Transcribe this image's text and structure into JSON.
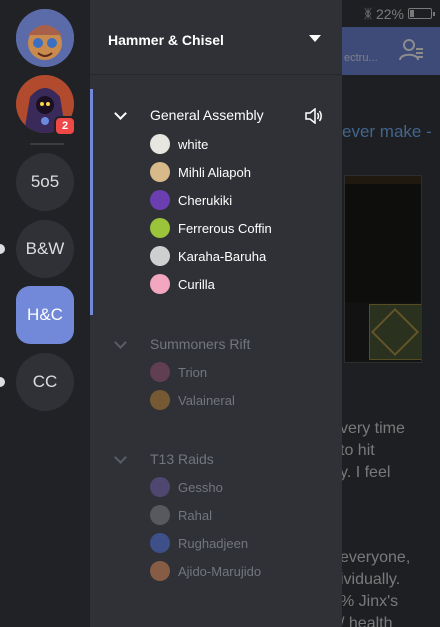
{
  "status_bar": {
    "battery_text": "22%",
    "battery_level": 0.22
  },
  "chat_header": {
    "topic_fragment": "ectru..."
  },
  "chat_background": {
    "link_text": "ever make -",
    "lines_block_1": [
      "very time",
      "to hit",
      "y. I feel"
    ],
    "lines_block_2": [
      "everyone,",
      "ividually.",
      "% Jinx's",
      "/ health"
    ]
  },
  "guilds": [
    {
      "label": "",
      "icon": "avatar-teemo",
      "active": false
    },
    {
      "label": "",
      "icon": "avatar-dark-mage",
      "active": false,
      "mention_count": "2"
    },
    {
      "label": "5o5",
      "active": false
    },
    {
      "label": "B&W",
      "active": false,
      "unread": true
    },
    {
      "label": "H&C",
      "active": true
    },
    {
      "label": "CC",
      "active": false,
      "unread": true
    }
  ],
  "server": {
    "name": "Hammer & Chisel"
  },
  "voice_categories": [
    {
      "name": "General Assembly",
      "state": "active",
      "members": [
        {
          "name": "white",
          "avatar_color": "#e8e6e0"
        },
        {
          "name": "Mihli Aliapoh",
          "avatar_color": "#d8b98a"
        },
        {
          "name": "Cherukiki",
          "avatar_color": "#6b3fb0"
        },
        {
          "name": "Ferrerous Coffin",
          "avatar_color": "#9bc43a"
        },
        {
          "name": "Karaha-Baruha",
          "avatar_color": "#cfcfcf"
        },
        {
          "name": "Curilla",
          "avatar_color": "#f2a6c0"
        }
      ]
    },
    {
      "name": "Summoners Rift",
      "state": "muted",
      "members": [
        {
          "name": "Trion",
          "avatar_color": "#8a4a6a"
        },
        {
          "name": "Valaineral",
          "avatar_color": "#b07a30"
        }
      ]
    },
    {
      "name": "T13 Raids",
      "state": "muted",
      "members": [
        {
          "name": "Gessho",
          "avatar_color": "#6a5aa0"
        },
        {
          "name": "Rahal",
          "avatar_color": "#7a7a80"
        },
        {
          "name": "Rughadjeen",
          "avatar_color": "#4a6ad0"
        },
        {
          "name": "Ajido-Marujido",
          "avatar_color": "#d08050"
        }
      ]
    }
  ],
  "colors": {
    "accent": "#7289da",
    "mention_badge": "#f04747",
    "link": "#7ab7ff"
  }
}
